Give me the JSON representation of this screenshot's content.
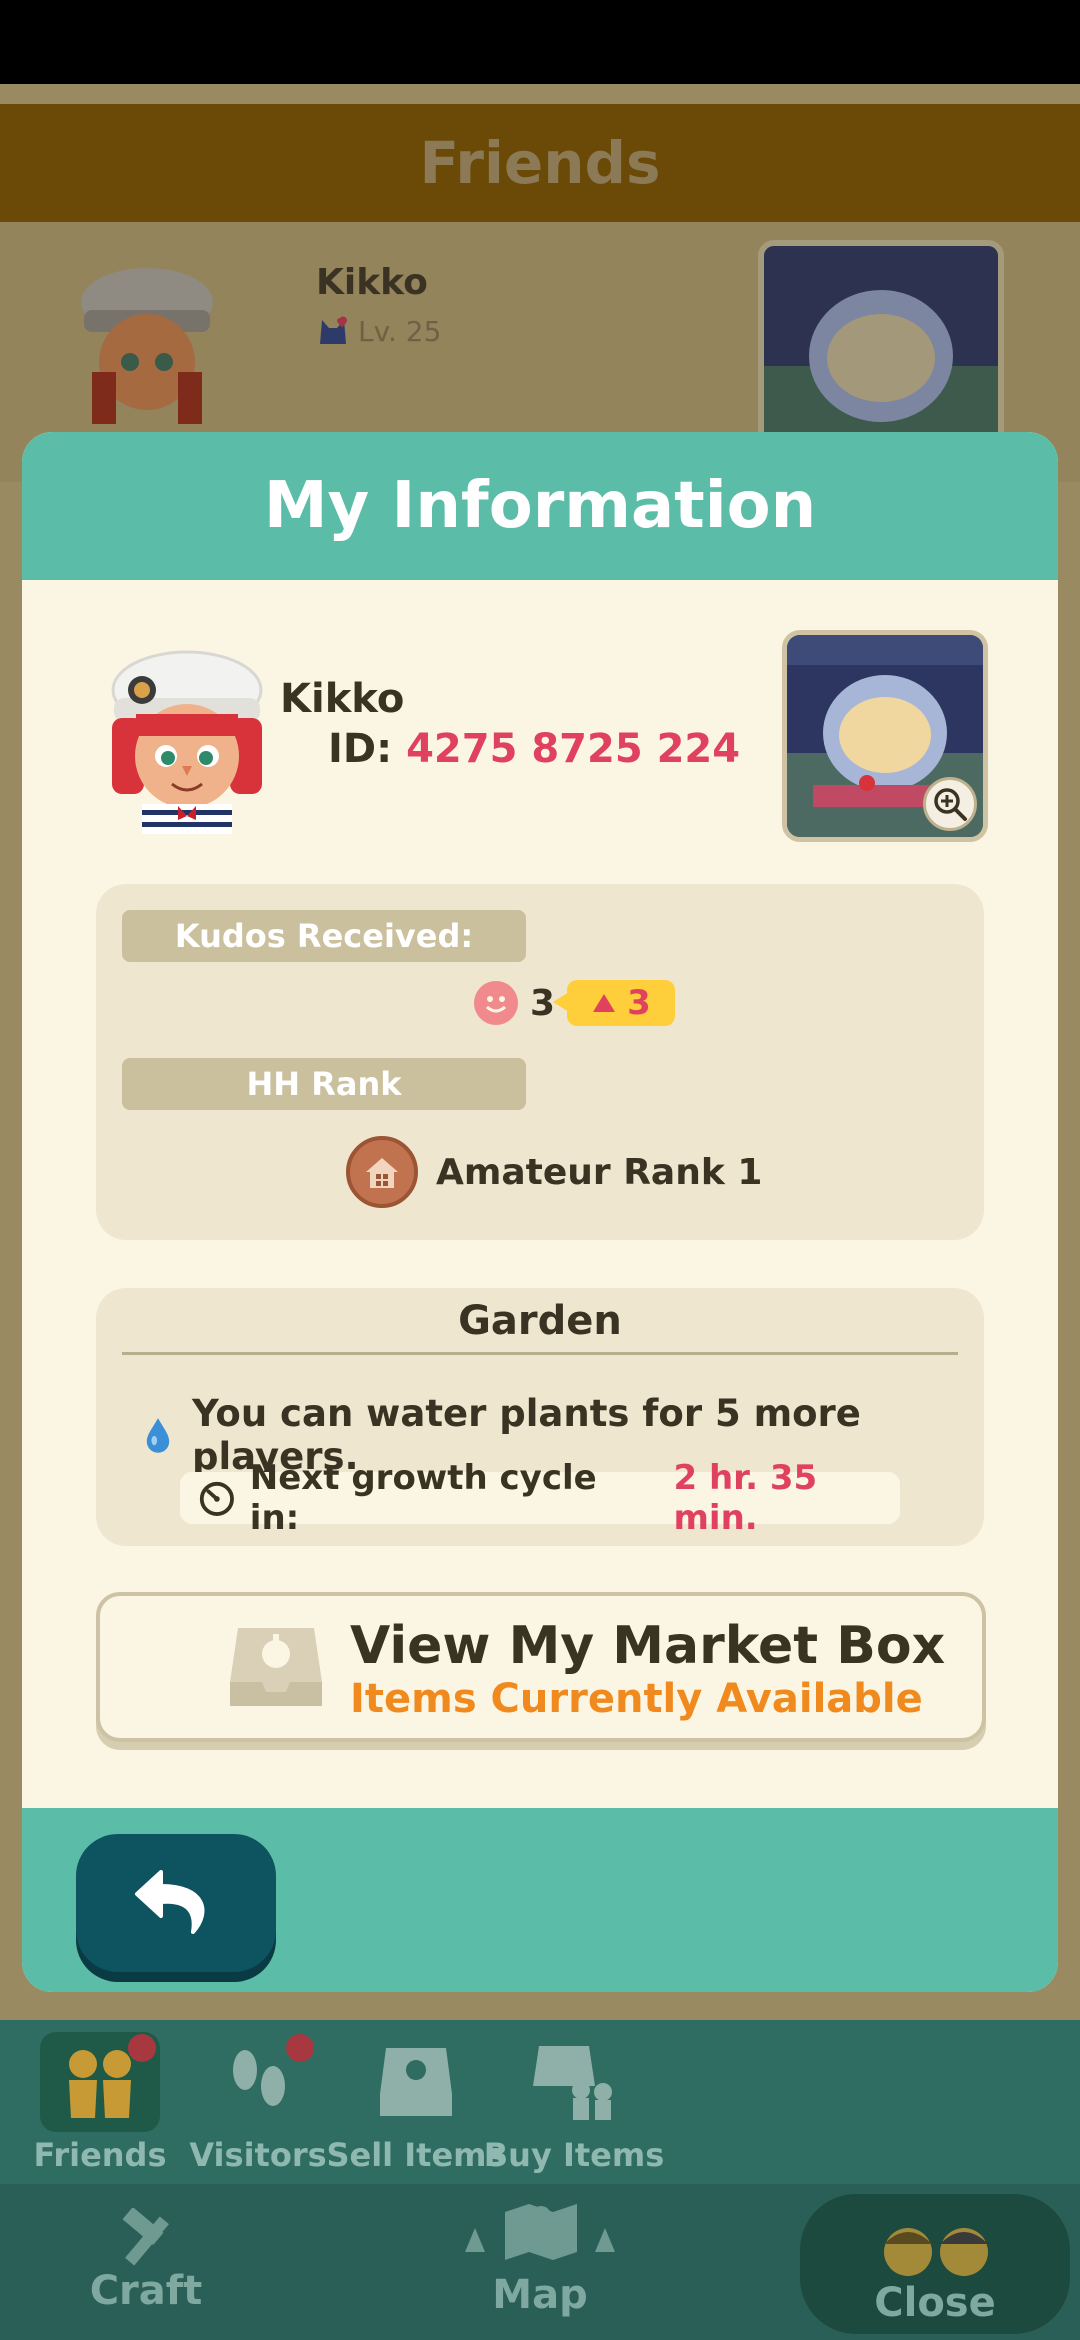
{
  "background": {
    "header_title": "Friends",
    "friend": {
      "name": "Kikko",
      "level": "Lv. 25"
    }
  },
  "modal": {
    "title": "My Information",
    "user": {
      "name": "Kikko",
      "id_label": "ID:",
      "id_value": "4275 8725 224"
    },
    "kudos": {
      "label": "Kudos Received:",
      "count": "3",
      "badge": "3"
    },
    "rank": {
      "label": "HH Rank",
      "value": "Amateur Rank 1"
    },
    "garden": {
      "title": "Garden",
      "water_text": "You can water plants for 5 more players.",
      "growth_label": "Next growth cycle in:",
      "growth_value": "2 hr. 35 min."
    },
    "market_box": {
      "title": "View My Market Box",
      "subtitle": "Items Currently Available"
    },
    "back_icon": "back-arrow-icon"
  },
  "nav": {
    "sub_items": [
      {
        "label": "Friends",
        "icon": "friends-icon",
        "badge": true
      },
      {
        "label": "Visitors",
        "icon": "footprints-icon",
        "badge": true
      },
      {
        "label": "Sell Items",
        "icon": "market-box-icon",
        "badge": false
      },
      {
        "label": "Buy Items",
        "icon": "shop-people-icon",
        "badge": false
      }
    ],
    "main_items": [
      {
        "label": "Craft",
        "icon": "hammer-icon"
      },
      {
        "label": "Map",
        "icon": "map-icon"
      },
      {
        "label": "Close",
        "icon": "villagers-icon"
      }
    ]
  },
  "colors": {
    "teal": "#5bbda8",
    "cream": "#fbf6e4",
    "accent_pink": "#e0415e",
    "accent_orange": "#f08a1e",
    "dark_teal_button": "#0e5360"
  }
}
